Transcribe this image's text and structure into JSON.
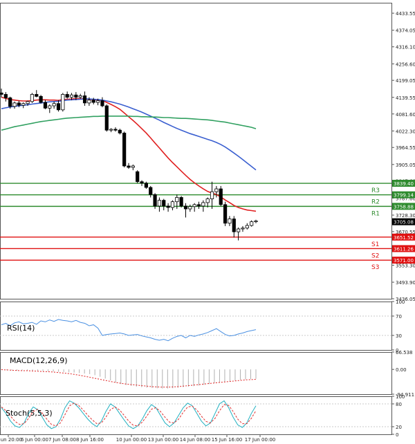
{
  "chart_data": [
    {
      "type": "candlestick",
      "panel": "price",
      "ylim": [
        3436.05,
        4470.0
      ],
      "y_ticks": [
        "4433.55",
        "4374.05",
        "4316.10",
        "4256.60",
        "4199.05",
        "4139.55",
        "4081.60",
        "4022.30",
        "3964.55",
        "3905.05",
        "3847.60",
        "3787.60",
        "3728.30",
        "3670.55",
        "3611.05",
        "3553.30",
        "3493.90",
        "3436.05"
      ],
      "x_ticks": [
        "2 Jun 20:00",
        "6 Jun 00:00",
        "7 Jun 08:00",
        "8 Jun 16:00",
        "10 Jun 00:00",
        "13 Jun 00:00",
        "14 Jun 08:00",
        "15 Jun 16:00",
        "17 Jun 00:00"
      ],
      "candles": [
        {
          "o": 4155,
          "h": 4170,
          "l": 4140,
          "c": 4150
        },
        {
          "o": 4150,
          "h": 4158,
          "l": 4125,
          "c": 4138
        },
        {
          "o": 4138,
          "h": 4142,
          "l": 4100,
          "c": 4108
        },
        {
          "o": 4108,
          "h": 4125,
          "l": 4100,
          "c": 4120
        },
        {
          "o": 4120,
          "h": 4128,
          "l": 4105,
          "c": 4112
        },
        {
          "o": 4112,
          "h": 4122,
          "l": 4102,
          "c": 4118
        },
        {
          "o": 4118,
          "h": 4128,
          "l": 4110,
          "c": 4125
        },
        {
          "o": 4125,
          "h": 4155,
          "l": 4120,
          "c": 4150
        },
        {
          "o": 4150,
          "h": 4165,
          "l": 4140,
          "c": 4143
        },
        {
          "o": 4143,
          "h": 4148,
          "l": 4118,
          "c": 4122
        },
        {
          "o": 4122,
          "h": 4130,
          "l": 4098,
          "c": 4102
        },
        {
          "o": 4102,
          "h": 4115,
          "l": 4085,
          "c": 4110
        },
        {
          "o": 4110,
          "h": 4125,
          "l": 4100,
          "c": 4118
        },
        {
          "o": 4118,
          "h": 4130,
          "l": 4090,
          "c": 4096
        },
        {
          "o": 4096,
          "h": 4155,
          "l": 4090,
          "c": 4150
        },
        {
          "o": 4150,
          "h": 4160,
          "l": 4135,
          "c": 4140
        },
        {
          "o": 4140,
          "h": 4155,
          "l": 4130,
          "c": 4148
        },
        {
          "o": 4148,
          "h": 4158,
          "l": 4130,
          "c": 4140
        },
        {
          "o": 4140,
          "h": 4152,
          "l": 4135,
          "c": 4145
        },
        {
          "o": 4145,
          "h": 4160,
          "l": 4110,
          "c": 4120
        },
        {
          "o": 4120,
          "h": 4140,
          "l": 4110,
          "c": 4130
        },
        {
          "o": 4130,
          "h": 4138,
          "l": 4115,
          "c": 4122
        },
        {
          "o": 4122,
          "h": 4135,
          "l": 4112,
          "c": 4128
        },
        {
          "o": 4128,
          "h": 4140,
          "l": 4105,
          "c": 4110
        },
        {
          "o": 4110,
          "h": 4115,
          "l": 4020,
          "c": 4025
        },
        {
          "o": 4025,
          "h": 4032,
          "l": 4018,
          "c": 4028
        },
        {
          "o": 4028,
          "h": 4035,
          "l": 4020,
          "c": 4025
        },
        {
          "o": 4025,
          "h": 4030,
          "l": 4010,
          "c": 4015
        },
        {
          "o": 4015,
          "h": 4020,
          "l": 3895,
          "c": 3900
        },
        {
          "o": 3900,
          "h": 3910,
          "l": 3890,
          "c": 3895
        },
        {
          "o": 3895,
          "h": 3905,
          "l": 3885,
          "c": 3900
        },
        {
          "o": 3880,
          "h": 3885,
          "l": 3840,
          "c": 3845
        },
        {
          "o": 3845,
          "h": 3850,
          "l": 3830,
          "c": 3840
        },
        {
          "o": 3840,
          "h": 3845,
          "l": 3820,
          "c": 3825
        },
        {
          "o": 3825,
          "h": 3830,
          "l": 3790,
          "c": 3800
        },
        {
          "o": 3800,
          "h": 3805,
          "l": 3750,
          "c": 3760
        },
        {
          "o": 3760,
          "h": 3790,
          "l": 3740,
          "c": 3780
        },
        {
          "o": 3780,
          "h": 3785,
          "l": 3745,
          "c": 3760
        },
        {
          "o": 3760,
          "h": 3770,
          "l": 3740,
          "c": 3755
        },
        {
          "o": 3755,
          "h": 3780,
          "l": 3745,
          "c": 3775
        },
        {
          "o": 3775,
          "h": 3800,
          "l": 3750,
          "c": 3790
        },
        {
          "o": 3790,
          "h": 3795,
          "l": 3755,
          "c": 3760
        },
        {
          "o": 3760,
          "h": 3770,
          "l": 3720,
          "c": 3750
        },
        {
          "o": 3750,
          "h": 3765,
          "l": 3740,
          "c": 3758
        },
        {
          "o": 3758,
          "h": 3770,
          "l": 3740,
          "c": 3765
        },
        {
          "o": 3765,
          "h": 3775,
          "l": 3750,
          "c": 3760
        },
        {
          "o": 3760,
          "h": 3780,
          "l": 3740,
          "c": 3772
        },
        {
          "o": 3772,
          "h": 3790,
          "l": 3755,
          "c": 3785
        },
        {
          "o": 3785,
          "h": 3845,
          "l": 3750,
          "c": 3810
        },
        {
          "o": 3810,
          "h": 3830,
          "l": 3790,
          "c": 3820
        },
        {
          "o": 3820,
          "h": 3830,
          "l": 3760,
          "c": 3765
        },
        {
          "o": 3765,
          "h": 3775,
          "l": 3690,
          "c": 3700
        },
        {
          "o": 3700,
          "h": 3725,
          "l": 3690,
          "c": 3715
        },
        {
          "o": 3715,
          "h": 3725,
          "l": 3650,
          "c": 3670
        },
        {
          "o": 3670,
          "h": 3685,
          "l": 3640,
          "c": 3680
        },
        {
          "o": 3680,
          "h": 3690,
          "l": 3670,
          "c": 3683
        },
        {
          "o": 3683,
          "h": 3700,
          "l": 3678,
          "c": 3692
        },
        {
          "o": 3692,
          "h": 3710,
          "l": 3688,
          "c": 3705
        },
        {
          "o": 3705,
          "h": 3712,
          "l": 3700,
          "c": 3708
        }
      ],
      "series": [
        {
          "color": "#e02020",
          "values": [
            4140,
            4136,
            4132,
            4130,
            4128,
            4127,
            4127,
            4128,
            4130,
            4131,
            4131,
            4130,
            4130,
            4129,
            4132,
            4133,
            4134,
            4135,
            4135,
            4134,
            4133,
            4132,
            4131,
            4129,
            4122,
            4115,
            4107,
            4098,
            4085,
            4072,
            4059,
            4045,
            4030,
            4015,
            3998,
            3980,
            3963,
            3945,
            3928,
            3912,
            3897,
            3882,
            3867,
            3853,
            3841,
            3830,
            3820,
            3811,
            3805,
            3800,
            3792,
            3781,
            3772,
            3762,
            3755,
            3750,
            3746,
            3744,
            3742
          ]
        },
        {
          "color": "#3a5fd0",
          "values": [
            4100,
            4103,
            4106,
            4108,
            4110,
            4112,
            4114,
            4116,
            4118,
            4120,
            4122,
            4124,
            4125,
            4126,
            4128,
            4130,
            4131,
            4132,
            4133,
            4134,
            4134,
            4133,
            4132,
            4130,
            4127,
            4124,
            4120,
            4116,
            4111,
            4106,
            4100,
            4094,
            4088,
            4081,
            4074,
            4067,
            4060,
            4052,
            4045,
            4038,
            4031,
            4025,
            4019,
            4013,
            4008,
            4003,
            3998,
            3993,
            3988,
            3982,
            3975,
            3966,
            3956,
            3945,
            3934,
            3922,
            3910,
            3898,
            3886
          ]
        },
        {
          "color": "#30a060",
          "values": [
            4025,
            4029,
            4033,
            4037,
            4040,
            4043,
            4046,
            4049,
            4052,
            4055,
            4057,
            4059,
            4061,
            4063,
            4065,
            4067,
            4068,
            4069,
            4070,
            4071,
            4072,
            4073,
            4073,
            4074,
            4074,
            4074,
            4074,
            4074,
            4074,
            4074,
            4073,
            4073,
            4072,
            4072,
            4071,
            4071,
            4070,
            4069,
            4069,
            4068,
            4067,
            4066,
            4066,
            4065,
            4064,
            4063,
            4062,
            4061,
            4059,
            4057,
            4055,
            4053,
            4050,
            4047,
            4044,
            4041,
            4038,
            4035,
            4030
          ]
        }
      ],
      "levels": [
        {
          "label": "R3",
          "value": 3839.4,
          "tag": "3839.40",
          "color": "#2e8b2e"
        },
        {
          "label": "R2",
          "value": 3799.14,
          "tag": "3799.14",
          "color": "#2e8b2e"
        },
        {
          "label": "R1",
          "value": 3758.88,
          "tag": "3758.88",
          "color": "#2e8b2e"
        },
        {
          "label": "S1",
          "value": 3651.52,
          "tag": "3651.52",
          "color": "#e01010"
        },
        {
          "label": "S2",
          "value": 3611.26,
          "tag": "3611.26",
          "color": "#e01010"
        },
        {
          "label": "S3",
          "value": 3571.0,
          "tag": "3571.00",
          "color": "#e01010"
        }
      ],
      "last_price": "3705.08"
    },
    {
      "type": "line",
      "panel": "rsi",
      "title": "RSI(14)",
      "ylim": [
        0,
        100
      ],
      "y_ticks": [
        "100",
        "70",
        "30",
        "0"
      ],
      "series": [
        {
          "color": "#4a90e2",
          "values": [
            52,
            55,
            50,
            56,
            58,
            54,
            55,
            57,
            53,
            60,
            58,
            62,
            59,
            63,
            61,
            60,
            58,
            61,
            57,
            55,
            50,
            52,
            45,
            30,
            32,
            33,
            34,
            35,
            33,
            30,
            31,
            32,
            29,
            27,
            25,
            22,
            20,
            22,
            19,
            24,
            28,
            30,
            25,
            30,
            28,
            31,
            33,
            36,
            40,
            44,
            38,
            32,
            29,
            30,
            33,
            35,
            38,
            40,
            42
          ]
        },
        {
          "color": "#c8c8c8",
          "values": []
        }
      ]
    },
    {
      "type": "histogram+line",
      "panel": "macd",
      "title": "MACD(12,26,9)",
      "ylim": [
        -94.911,
        66.538
      ],
      "y_ticks": [
        "66.538",
        "0.00",
        "-94.911"
      ],
      "histogram": [
        -2,
        -3,
        -4,
        -5,
        -4,
        -5,
        -6,
        -5,
        -6,
        -7,
        -8,
        -9,
        -10,
        -11,
        -12,
        -14,
        -16,
        -18,
        -22,
        -28,
        -35,
        -42,
        -50,
        -56,
        -60,
        -63,
        -66,
        -68,
        -70,
        -71,
        -72,
        -73,
        -73,
        -72,
        -70,
        -68,
        -66,
        -64,
        -62,
        -59,
        -56,
        -52,
        -50,
        -48,
        -45,
        -42,
        -40,
        -38,
        -37,
        -36
      ],
      "signal": [
        -1,
        -2,
        -3,
        -4,
        -5,
        -5,
        -6,
        -7,
        -8,
        -9,
        -10,
        -12,
        -14,
        -16,
        -19,
        -22,
        -26,
        -30,
        -34,
        -38,
        -42,
        -46,
        -50,
        -53,
        -56,
        -58,
        -60,
        -62,
        -64,
        -66,
        -67,
        -68,
        -68,
        -67,
        -66,
        -64,
        -62,
        -60,
        -58,
        -56,
        -54,
        -52,
        -50,
        -48,
        -46,
        -44,
        -42,
        -40,
        -39,
        -38
      ]
    },
    {
      "type": "line",
      "panel": "stoch",
      "title": "Stoch(5,5,3)",
      "ylim": [
        0,
        100
      ],
      "y_ticks": [
        "100",
        "80",
        "20",
        "0"
      ],
      "series": [
        {
          "color": "#20b0c0",
          "values": [
            70,
            55,
            35,
            22,
            18,
            30,
            55,
            72,
            65,
            45,
            25,
            15,
            20,
            40,
            70,
            88,
            82,
            70,
            55,
            40,
            28,
            20,
            35,
            60,
            80,
            72,
            55,
            38,
            22,
            15,
            22,
            40,
            62,
            78,
            70,
            50,
            30,
            20,
            30,
            50,
            70,
            82,
            75,
            55,
            35,
            22,
            30,
            55,
            80,
            88,
            70,
            45,
            25,
            18,
            30,
            55,
            75
          ]
        },
        {
          "color": "#e03030",
          "values": [
            72,
            62,
            48,
            34,
            26,
            28,
            42,
            60,
            66,
            56,
            40,
            26,
            22,
            30,
            52,
            75,
            82,
            76,
            64,
            50,
            38,
            28,
            30,
            45,
            65,
            72,
            64,
            50,
            35,
            24,
            22,
            32,
            48,
            66,
            70,
            60,
            45,
            32,
            30,
            40,
            58,
            72,
            74,
            64,
            48,
            34,
            30,
            42,
            62,
            78,
            76,
            60,
            40,
            28,
            28,
            42,
            62
          ]
        }
      ]
    }
  ]
}
